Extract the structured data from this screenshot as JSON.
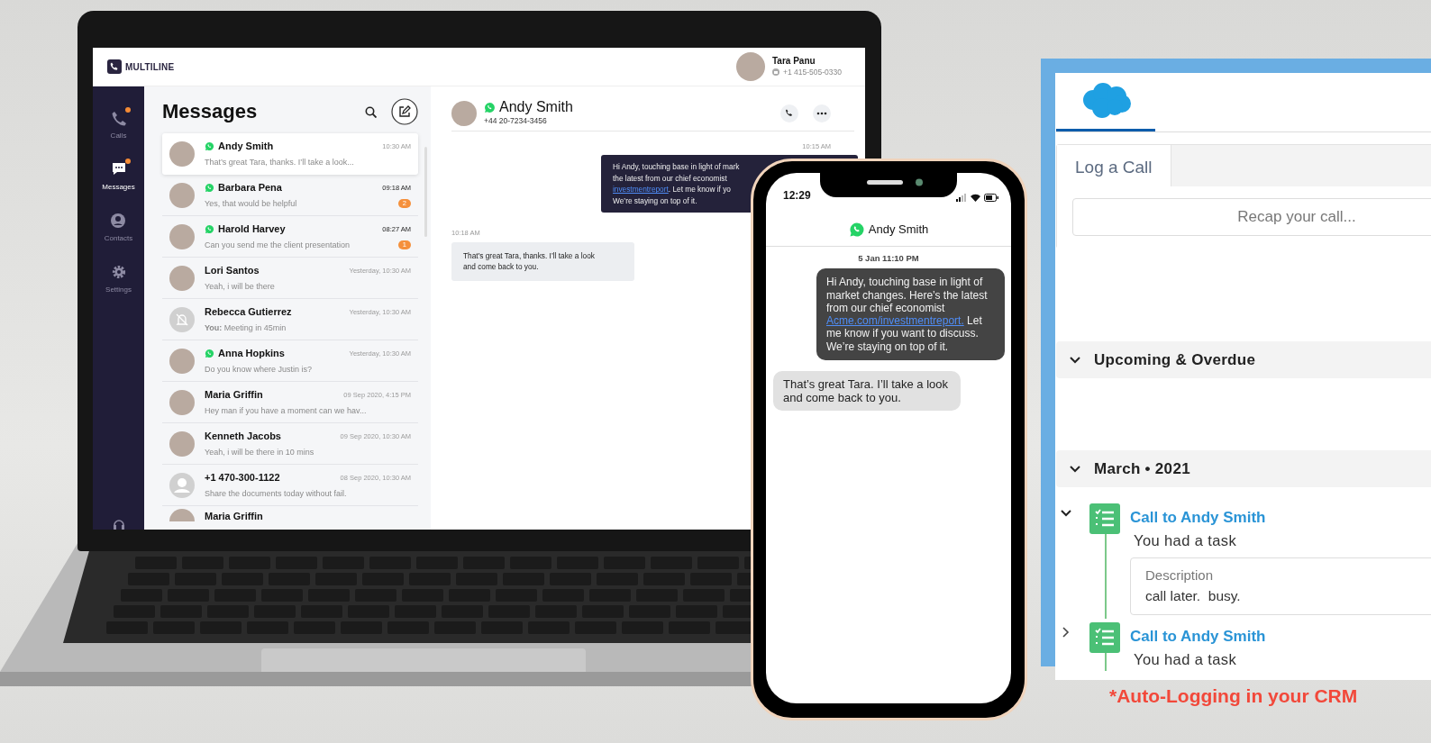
{
  "laptop_app": {
    "brand": "MULTILINE",
    "user": {
      "name": "Tara Panu",
      "phone": "+1 415-505-0330"
    },
    "nav": [
      {
        "kind": "calls",
        "label": "Calls",
        "selected": false,
        "notification": true
      },
      {
        "kind": "messages",
        "label": "Messages",
        "selected": true,
        "notification": true
      },
      {
        "kind": "contacts",
        "label": "Contacts",
        "selected": false,
        "notification": false
      },
      {
        "kind": "settings",
        "label": "Settings",
        "selected": false,
        "notification": false
      }
    ],
    "messages": {
      "title": "Messages",
      "conversations": [
        {
          "name": "Andy Smith",
          "time": "10:30 AM",
          "preview": "That’s great Tara, thanks. I’ll take a look...",
          "whatsapp": true,
          "kind": "photo",
          "selected": true
        },
        {
          "name": "Barbara Pena",
          "time": "09:18 AM",
          "preview": "Yes, that would be helpful",
          "whatsapp": true,
          "kind": "photo",
          "selected": false,
          "unread": "2"
        },
        {
          "name": "Harold Harvey",
          "time": "08:27 AM",
          "preview": "Can you send me the client presentation",
          "whatsapp": true,
          "kind": "photo",
          "selected": false,
          "unread": "1"
        },
        {
          "name": "Lori Santos",
          "time": "Yesterday, 10:30 AM",
          "preview": "Yeah, i will be there",
          "whatsapp": false,
          "kind": "photo",
          "selected": false
        },
        {
          "name": "Rebecca Gutierrez",
          "time": "Yesterday, 10:30 AM",
          "preview": "**You:**  Meeting in 45min",
          "whatsapp": false,
          "kind": "muted",
          "selected": false
        },
        {
          "name": "Anna Hopkins",
          "time": "Yesterday, 10:30 AM",
          "preview": "Do you know where Justin is?",
          "whatsapp": true,
          "kind": "photo",
          "selected": false
        },
        {
          "name": "Maria Griffin",
          "time": "09 Sep 2020, 4:15 PM",
          "preview": "Hey man if you have a moment can we hav...",
          "whatsapp": false,
          "kind": "photo",
          "selected": false
        },
        {
          "name": "Kenneth Jacobs",
          "time": "09 Sep 2020, 10:30 AM",
          "preview": "Yeah, i will be there in 10 mins",
          "whatsapp": false,
          "kind": "photo",
          "selected": false
        },
        {
          "name": "+1 470-300-1122",
          "time": "08 Sep 2020, 10:30 AM",
          "preview": "Share the documents today without fail.",
          "whatsapp": false,
          "kind": "generic",
          "selected": false
        },
        {
          "name": "Maria Griffin",
          "whatsapp": false,
          "kind": "photo",
          "selected": false
        }
      ]
    },
    "chat": {
      "name": "Andy Smith",
      "phone": "+44 20-7234-3456",
      "whatsapp": true,
      "messages": [
        {
          "kind": "out",
          "time": "10:15 AM",
          "lines": [
            [
              {
                "text": "Hi Andy, touching base in light of mark",
                "link": false
              }
            ],
            [
              {
                "text": "the latest from our chief economist",
                "link": false
              }
            ],
            [
              {
                "text": "investmentreport",
                "link": true
              },
              {
                "text": ". Let me know if yo",
                "link": false
              }
            ],
            [
              {
                "text": "We’re staying on top of it.",
                "link": false
              }
            ]
          ]
        },
        {
          "kind": "in",
          "time": "10:18 AM",
          "lines": [
            [
              {
                "text": "That’s great Tara, thanks. I’ll take a look",
                "link": false
              }
            ],
            [
              {
                "text": "and come back to you.",
                "link": false
              }
            ]
          ]
        }
      ]
    }
  },
  "phone": {
    "time": "12:29",
    "contact": "Andy Smith",
    "date": "5 Jan 11:10 PM",
    "messages": [
      {
        "kind": "out",
        "parts": [
          {
            "text": "Hi Andy, touching base in light of market changes. Here’s the latest from our chief economist ",
            "link": false
          },
          {
            "text": "Acme.com/investmentreport.",
            "link": true
          },
          {
            "text": " Let me know if you want to discuss. We’re staying on top of it.",
            "link": false
          }
        ]
      },
      {
        "kind": "in",
        "parts": [
          {
            "text": "That’s great Tara. I’ll take a look and come back to you.",
            "link": false
          }
        ]
      }
    ]
  },
  "crm": {
    "tabs": [
      {
        "label": "Log a Call",
        "selected": true
      }
    ],
    "input": {
      "placeholder": "Recap your call..."
    },
    "sections": [
      {
        "title": "Upcoming & Overdue",
        "expanded": true
      },
      {
        "title": "March • 2021",
        "expanded": true,
        "items": [
          {
            "title": "Call to Andy Smith",
            "subtitle": "You had a task",
            "expanded": true,
            "description_label": "Description",
            "description": "call later.  busy."
          },
          {
            "title": "Call to Andy Smith",
            "subtitle": "You had a task",
            "expanded": false
          }
        ]
      }
    ]
  },
  "caption": "*Auto-Logging in your CRM"
}
